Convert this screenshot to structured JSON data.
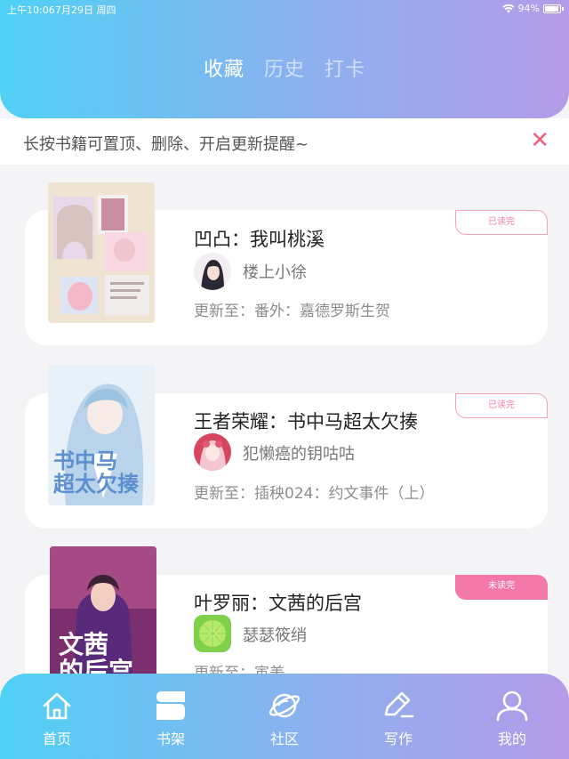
{
  "status": {
    "time": "上午10:06",
    "date": "7月29日 周四",
    "battery": "94%"
  },
  "tabs": [
    {
      "label": "收藏",
      "active": true
    },
    {
      "label": "历史",
      "active": false
    },
    {
      "label": "打卡",
      "active": false
    }
  ],
  "tip": {
    "text": "长按书籍可置顶、删除、开启更新提醒~",
    "close_icon": "close-icon"
  },
  "books": [
    {
      "title": "凹凸：我叫桃溪",
      "author": "楼上小徐",
      "update": "更新至：番外：嘉德罗斯生贺",
      "badge": "已读完",
      "badge_state": "read"
    },
    {
      "title": "王者荣耀：书中马超太欠揍",
      "author": "犯懒癌的钥咕咕",
      "update": "更新至：插秧024：约文事件（上）",
      "badge": "已读完",
      "badge_state": "read"
    },
    {
      "title": "叶罗丽：文茜的后宫",
      "author": "瑟瑟筱绡",
      "update": "更新至：寅美",
      "badge": "未读完",
      "badge_state": "unread"
    }
  ],
  "nav": [
    {
      "label": "首页",
      "icon": "home-icon"
    },
    {
      "label": "书架",
      "icon": "bookshelf-icon"
    },
    {
      "label": "社区",
      "icon": "planet-icon"
    },
    {
      "label": "写作",
      "icon": "pen-icon"
    },
    {
      "label": "我的",
      "icon": "user-icon"
    }
  ],
  "colors": {
    "gradient_start": "#4fd1f5",
    "gradient_end": "#b49be8",
    "accent_pink": "#f377a8"
  }
}
